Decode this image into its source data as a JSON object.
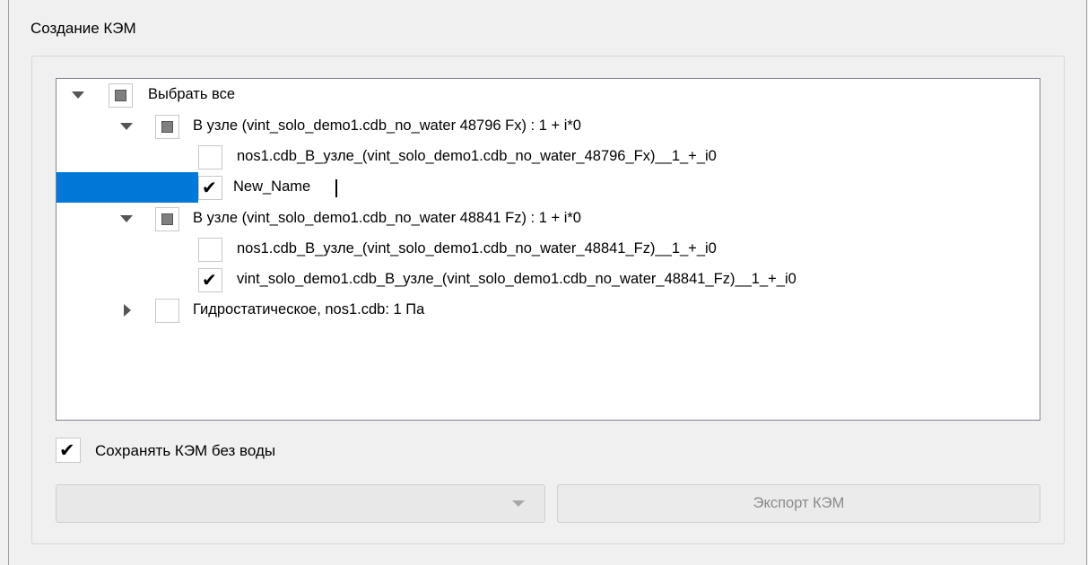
{
  "group": {
    "title": "Создание КЭМ"
  },
  "tree": {
    "select_all": "Выбрать все",
    "node1": "В узле (vint_solo_demo1.cdb_no_water 48796 Fx) : 1 + i*0",
    "node1_child1": "nos1.cdb_B_узле_(vint_solo_demo1.cdb_no_water_48796_Fx)__1_+_i0",
    "node1_child2_edit": "New_Name",
    "node2": "В узле (vint_solo_demo1.cdb_no_water 48841 Fz) : 1 + i*0",
    "node2_child1": "nos1.cdb_B_узле_(vint_solo_demo1.cdb_no_water_48841_Fz)__1_+_i0",
    "node2_child2": "vint_solo_demo1.cdb_B_узле_(vint_solo_demo1.cdb_no_water_48841_Fz)__1_+_i0",
    "node3": "Гидростатическое, nos1.cdb: 1 Па"
  },
  "options": {
    "save_without_water": "Сохранять КЭМ без воды"
  },
  "combo": {
    "value": ""
  },
  "buttons": {
    "export": "Экспорт КЭМ"
  },
  "colors": {
    "selection": "#0078d7",
    "background": "#f0f0f0"
  }
}
